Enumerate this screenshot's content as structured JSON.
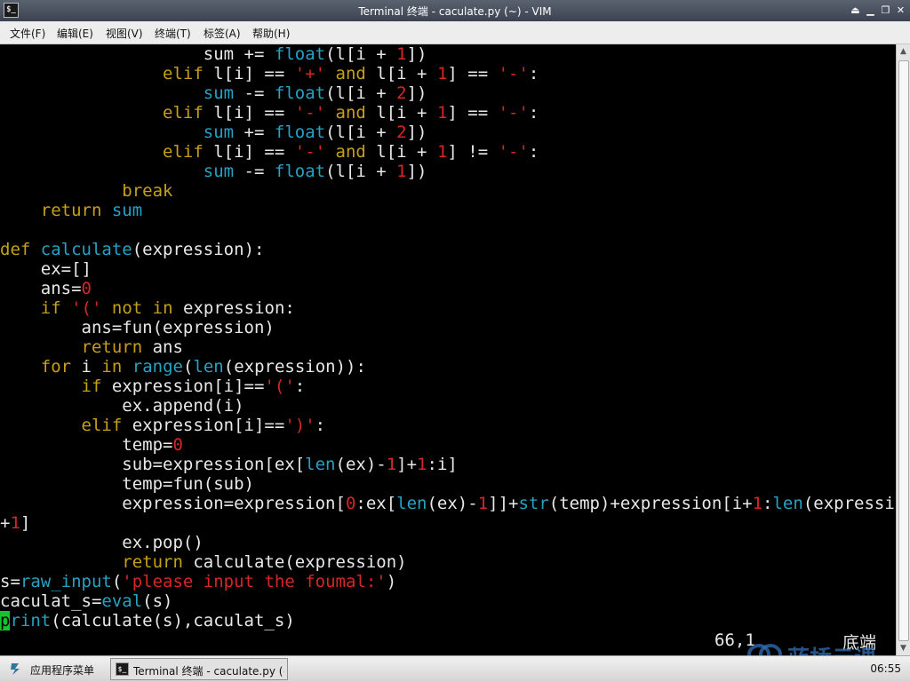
{
  "window": {
    "title": "Terminal 终端 - caculate.py (~) - VIM",
    "app_icon": "terminal-icon",
    "controls": [
      "eject-icon",
      "minimize-icon",
      "restore-icon",
      "close-icon"
    ]
  },
  "menu": {
    "items": [
      "文件(F)",
      "编辑(E)",
      "视图(V)",
      "终端(T)",
      "标签(A)",
      "帮助(H)"
    ]
  },
  "editor": {
    "cursor_position": "66,1",
    "scroll_mode": "底端",
    "lines": [
      [
        [
          "                    ",
          ""
        ],
        [
          "sum",
          ""
        ],
        [
          " += ",
          ""
        ],
        [
          "float",
          "cyan"
        ],
        [
          "(l[i + ",
          ""
        ],
        [
          "1",
          "red"
        ],
        [
          "])",
          ""
        ]
      ],
      [
        [
          "                ",
          ""
        ],
        [
          "elif",
          "yel"
        ],
        [
          " l[i] == ",
          ""
        ],
        [
          "'+'",
          "red"
        ],
        [
          " ",
          ""
        ],
        [
          "and",
          "yel"
        ],
        [
          " l[i + ",
          ""
        ],
        [
          "1",
          "red"
        ],
        [
          "] == ",
          ""
        ],
        [
          "'-'",
          "red"
        ],
        [
          ":",
          ""
        ]
      ],
      [
        [
          "                    ",
          ""
        ],
        [
          "sum",
          "cyan"
        ],
        [
          " -= ",
          ""
        ],
        [
          "float",
          "cyan"
        ],
        [
          "(l[i + ",
          ""
        ],
        [
          "2",
          "red"
        ],
        [
          "])",
          ""
        ]
      ],
      [
        [
          "                ",
          ""
        ],
        [
          "elif",
          "yel"
        ],
        [
          " l[i] == ",
          ""
        ],
        [
          "'-'",
          "red"
        ],
        [
          " ",
          ""
        ],
        [
          "and",
          "yel"
        ],
        [
          " l[i + ",
          ""
        ],
        [
          "1",
          "red"
        ],
        [
          "] == ",
          ""
        ],
        [
          "'-'",
          "red"
        ],
        [
          ":",
          ""
        ]
      ],
      [
        [
          "                    ",
          ""
        ],
        [
          "sum",
          "cyan"
        ],
        [
          " += ",
          ""
        ],
        [
          "float",
          "cyan"
        ],
        [
          "(l[i + ",
          ""
        ],
        [
          "2",
          "red"
        ],
        [
          "])",
          ""
        ]
      ],
      [
        [
          "                ",
          ""
        ],
        [
          "elif",
          "yel"
        ],
        [
          " l[i] == ",
          ""
        ],
        [
          "'-'",
          "red"
        ],
        [
          " ",
          ""
        ],
        [
          "and",
          "yel"
        ],
        [
          " l[i + ",
          ""
        ],
        [
          "1",
          "red"
        ],
        [
          "] != ",
          ""
        ],
        [
          "'-'",
          "red"
        ],
        [
          ":",
          ""
        ]
      ],
      [
        [
          "                    ",
          ""
        ],
        [
          "sum",
          "cyan"
        ],
        [
          " -= ",
          ""
        ],
        [
          "float",
          "cyan"
        ],
        [
          "(l[i + ",
          ""
        ],
        [
          "1",
          "red"
        ],
        [
          "])",
          ""
        ]
      ],
      [
        [
          "            ",
          ""
        ],
        [
          "break",
          "yel"
        ]
      ],
      [
        [
          "    ",
          ""
        ],
        [
          "return",
          "yel"
        ],
        [
          " ",
          ""
        ],
        [
          "sum",
          "cyan"
        ]
      ],
      [],
      [
        [
          "def",
          "yel"
        ],
        [
          " ",
          ""
        ],
        [
          "calculate",
          "cyan"
        ],
        [
          "(expression):",
          ""
        ]
      ],
      [
        [
          "    ex=[]",
          ""
        ]
      ],
      [
        [
          "    ans=",
          ""
        ],
        [
          "0",
          "red"
        ]
      ],
      [
        [
          "    ",
          ""
        ],
        [
          "if",
          "yel"
        ],
        [
          " ",
          ""
        ],
        [
          "'('",
          "red"
        ],
        [
          " ",
          ""
        ],
        [
          "not",
          "yel"
        ],
        [
          " ",
          ""
        ],
        [
          "in",
          "yel"
        ],
        [
          " expression:",
          ""
        ]
      ],
      [
        [
          "        ans=fun(expression)",
          ""
        ]
      ],
      [
        [
          "        ",
          ""
        ],
        [
          "return",
          "yel"
        ],
        [
          " ans",
          ""
        ]
      ],
      [
        [
          "    ",
          ""
        ],
        [
          "for",
          "yel"
        ],
        [
          " i ",
          ""
        ],
        [
          "in",
          "yel"
        ],
        [
          " ",
          ""
        ],
        [
          "range",
          "cyan"
        ],
        [
          "(",
          ""
        ],
        [
          "len",
          "cyan"
        ],
        [
          "(expression)):",
          ""
        ]
      ],
      [
        [
          "        ",
          ""
        ],
        [
          "if",
          "yel"
        ],
        [
          " expression[i]==",
          ""
        ],
        [
          "'('",
          "red"
        ],
        [
          ":",
          ""
        ]
      ],
      [
        [
          "            ex.append(i)",
          ""
        ]
      ],
      [
        [
          "        ",
          ""
        ],
        [
          "elif",
          "yel"
        ],
        [
          " expression[i]==",
          ""
        ],
        [
          "')'",
          "red"
        ],
        [
          ":",
          ""
        ]
      ],
      [
        [
          "            temp=",
          ""
        ],
        [
          "0",
          "red"
        ]
      ],
      [
        [
          "            sub=expression[ex[",
          ""
        ],
        [
          "len",
          "cyan"
        ],
        [
          "(ex)-",
          ""
        ],
        [
          "1",
          "red"
        ],
        [
          "]+",
          ""
        ],
        [
          "1",
          "red"
        ],
        [
          ":i]",
          ""
        ]
      ],
      [
        [
          "            temp=fun(sub)",
          ""
        ]
      ],
      [
        [
          "            expression=expression[",
          ""
        ],
        [
          "0",
          "red"
        ],
        [
          ":ex[",
          ""
        ],
        [
          "len",
          "cyan"
        ],
        [
          "(ex)-",
          ""
        ],
        [
          "1",
          "red"
        ],
        [
          "]]+",
          ""
        ],
        [
          "str",
          "cyan"
        ],
        [
          "(temp)+expression[i+",
          ""
        ],
        [
          "1",
          "red"
        ],
        [
          ":",
          ""
        ],
        [
          "len",
          "cyan"
        ],
        [
          "(expression)",
          ""
        ]
      ],
      [
        [
          "+",
          ""
        ],
        [
          "1",
          "red"
        ],
        [
          "]",
          ""
        ]
      ],
      [
        [
          "            ex.pop()",
          ""
        ]
      ],
      [
        [
          "            ",
          ""
        ],
        [
          "return",
          "yel"
        ],
        [
          " calculate(expression)",
          ""
        ]
      ],
      [
        [
          "s=",
          ""
        ],
        [
          "raw_input",
          "cyan"
        ],
        [
          "(",
          ""
        ],
        [
          "'please input the foumal:'",
          "red"
        ],
        [
          ")",
          ""
        ]
      ],
      [
        [
          "caculat_s=",
          ""
        ],
        [
          "eval",
          "cyan"
        ],
        [
          "(s)",
          ""
        ]
      ],
      [
        [
          "p",
          "cursor"
        ],
        [
          "rint",
          "cyan"
        ],
        [
          "(calculate(s),caculat_s)",
          ""
        ]
      ]
    ]
  },
  "watermark": {
    "icon": "lanqiao-logo-icon",
    "text": "蓝桥云课"
  },
  "taskbar": {
    "start_label": "应用程序菜单",
    "start_icon": "app-menu-icon",
    "task_label": "Terminal 终端 - caculate.py (~) - VIM",
    "clock": "06:55"
  }
}
